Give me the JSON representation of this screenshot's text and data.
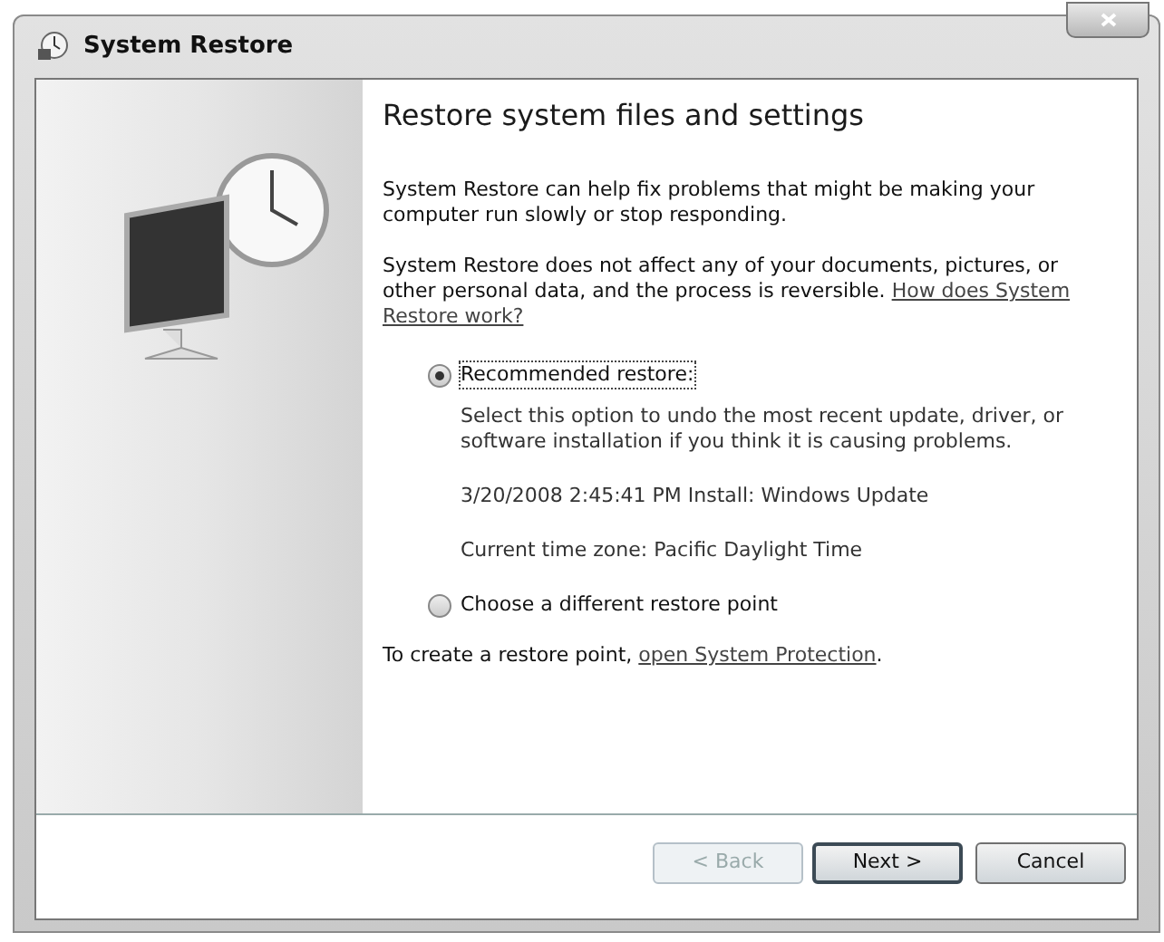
{
  "window": {
    "title": "System Restore"
  },
  "heading": "Restore system files and settings",
  "paragraphs": [
    {
      "text": "System Restore can help fix problems that might be making your computer run slowly or stop responding."
    },
    {
      "text": "System Restore does not affect any of your documents, pictures, or other personal data, and the process is reversible.",
      "link_lines": [
        "How does System",
        "Restore work?"
      ]
    }
  ],
  "options": [
    {
      "label": "Recommended restore:",
      "selected": true,
      "description": "Select this option to undo the most recent update, driver, or software installation if you think it is causing problems.",
      "details": [
        "3/20/2008 2:45:41 PM Install: Windows Update",
        "Current time zone: Pacific Daylight Time"
      ]
    },
    {
      "label": "Choose a different restore point",
      "selected": false
    }
  ],
  "footer_note": {
    "text": "To create a restore point,",
    "link": "open System Protection",
    "after": "."
  },
  "buttons": [
    {
      "label": "< Back",
      "disabled": true,
      "default": false
    },
    {
      "label": "Next >",
      "disabled": false,
      "default": true
    },
    {
      "label": "Cancel",
      "disabled": false,
      "default": false
    }
  ]
}
